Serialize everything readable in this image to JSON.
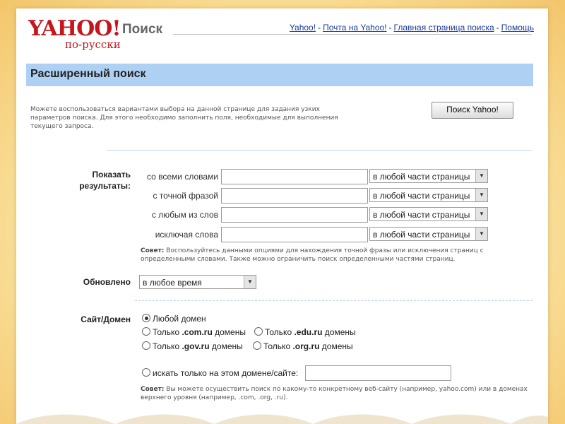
{
  "header": {
    "logo_text": "YAHOO!",
    "logo_sub": "по-русски",
    "search_title": "Поиск",
    "nav": [
      "Yahoo!",
      "Почта на Yahoo!",
      "Главная страница поиска",
      "Помощь"
    ],
    "nav_sep": "-"
  },
  "title": "Расширенный поиск",
  "intro": "Можете воспользоваться вариантами выбора на данной странице для задания узких параметров поиска. Для этого необходимо заполнить поля, необходимые для выполнения текущего запроса.",
  "search_button": "Поиск Yahoo!",
  "show_results": {
    "label_line1": "Показать",
    "label_line2": "результаты:",
    "rows": [
      {
        "label": "со всеми словами",
        "input_value": "",
        "select_value": "в любой части страницы"
      },
      {
        "label": "с точной фразой",
        "input_value": "",
        "select_value": "в любой части страницы"
      },
      {
        "label": "с любым из слов",
        "input_value": "",
        "select_value": "в любой части страницы"
      },
      {
        "label": "исключая слова",
        "input_value": "",
        "select_value": "в любой части страницы"
      }
    ],
    "tip_bold": "Совет:",
    "tip_text": " Воспользуйтесь данными опциями для нахождения точной фразы или исключения страниц с определенными словами. Также можно ограничить поиск определенными частями страниц."
  },
  "updated": {
    "label": "Обновлено",
    "select_value": "в любое время"
  },
  "site_domain": {
    "label": "Сайт/Домен",
    "options": {
      "any": "Любой домен",
      "com_ru_prefix": "Только ",
      "com_ru": ".com.ru",
      "edu_ru_prefix": "Только ",
      "edu_ru": ".edu.ru",
      "gov_ru_prefix": "Только ",
      "gov_ru": ".gov.ru",
      "org_ru_prefix": "Только ",
      "org_ru": ".org.ru",
      "suffix": " домены"
    },
    "site_only_label": "искать только на этом домене/сайте:",
    "site_input_value": "",
    "tip_bold": "Совет:",
    "tip_text": " Вы можете осуществить поиск по какому-то конкретному веб-сайту (например, yahoo.com) или в доменах верхнего уровня (например, .com, .org, .ru)."
  },
  "colors": {
    "brand_red": "#c4161c",
    "title_bar": "#aed1f3",
    "link": "#1a3d9c"
  }
}
